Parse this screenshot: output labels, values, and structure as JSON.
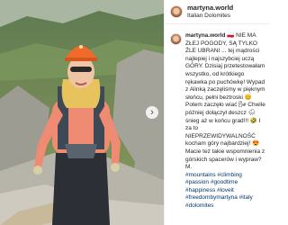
{
  "post": {
    "username": "martyna.world",
    "location": "Italian Dolomites",
    "caption_username": "martyna.world",
    "caption_text": "🇵🇱 NIE MA ZŁEJ POGODY, SĄ TYLKO ŹLE UBRANI ... tej mądrości najlepiej i najszybciej uczą GÓRY. Dzisiaj przetestowałam wszystko, od krótkiego rękawka po puchówkę! Wypad z Alinką zaczęliśmy w pięknym słońcu, pełni beztroski 😊 Potem zaczęło wiać 🌬 Chwile później dołączył deszcz 🌧 śnieg aż w końcu grad!!! 🤣 I za to NIEPRZEWIDYWALNOŚĆ kocham góry najbardziej! 😍 Macie też takie wspomnienia z górskich spacerów i wypraw? M.",
    "hashtags": "#mountains #climbing #passion #goodtime #happiness #loveit #freedombymartyna #italy #dolomites",
    "next_icon": "chevron-right-icon"
  }
}
